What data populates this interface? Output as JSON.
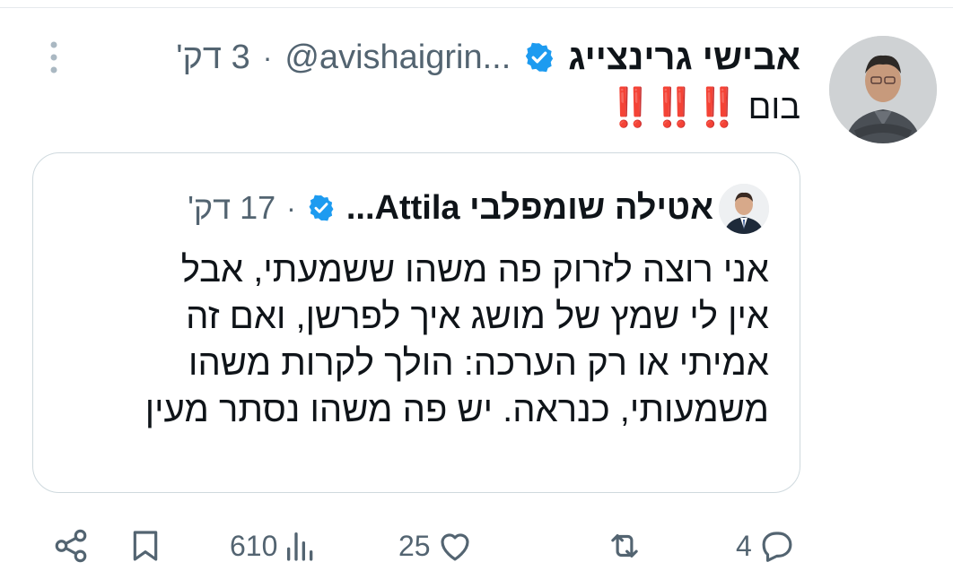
{
  "author": {
    "name": "אבישי גרינצייג",
    "handle": "@avishaigrin...",
    "separator": "·",
    "time": "3 דק'"
  },
  "tweet": {
    "text": "בום",
    "emphasis": "‼️‼️‼️"
  },
  "quoted": {
    "name": "אטילה שומפלבי Attila...",
    "separator": "·",
    "time": "17 דק'",
    "lines": [
      "אני רוצה לזרוק פה משהו ששמעתי, אבל",
      "אין לי שמץ של מושג איך לפרשן, ואם זה",
      "אמיתי או רק הערכה: הולך לקרות משהו",
      "משמעותי, כנראה. יש פה משהו נסתר מעין"
    ]
  },
  "actions": {
    "replies": "4",
    "retweets": "",
    "likes": "25",
    "views": "610"
  },
  "icons": [
    "more-vertical-icon",
    "verified-badge-icon",
    "reply-icon",
    "retweet-icon",
    "like-icon",
    "views-icon",
    "bookmark-icon",
    "share-icon"
  ],
  "colors": {
    "accent": "#1d9bf0",
    "muted": "#536471",
    "emphasis": "#e0245e"
  }
}
